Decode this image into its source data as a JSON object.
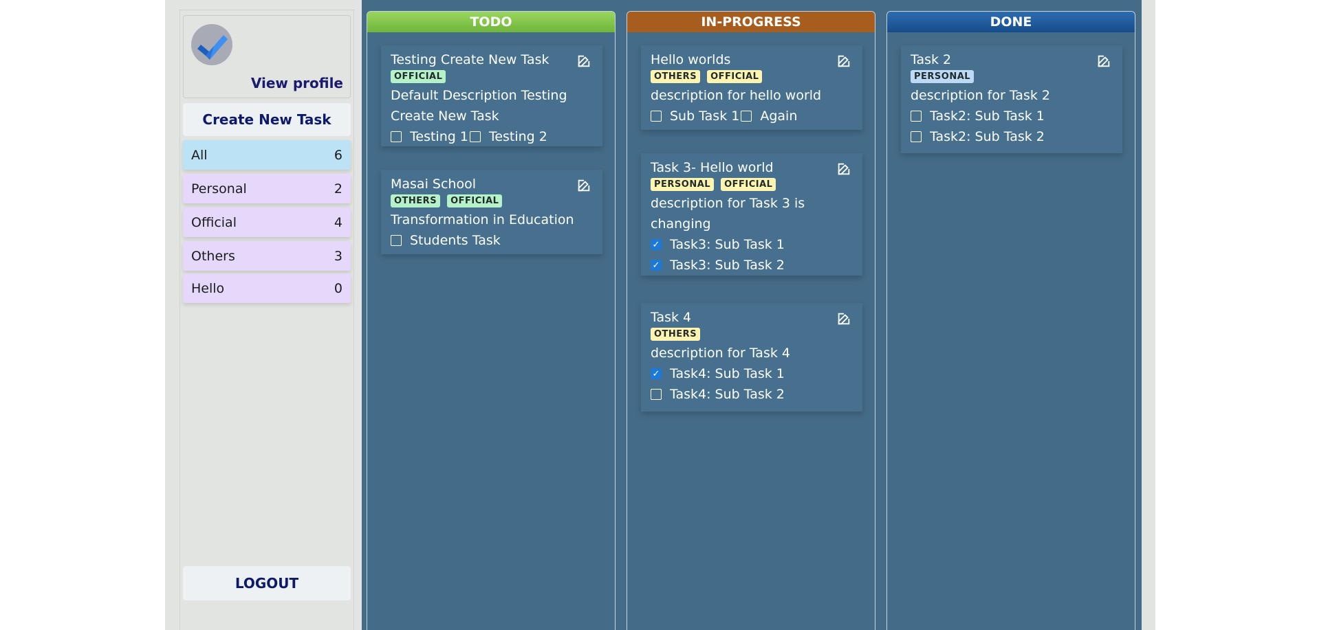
{
  "sidebar": {
    "view_profile": "View profile",
    "create_task": "Create New Task",
    "logout": "LOGOUT",
    "categories": [
      {
        "label": "All",
        "count": "6"
      },
      {
        "label": "Personal",
        "count": "2"
      },
      {
        "label": "Official",
        "count": "4"
      },
      {
        "label": "Others",
        "count": "3"
      },
      {
        "label": "Hello",
        "count": "0"
      }
    ]
  },
  "colors": {
    "todo": "#7cc243",
    "inprogress": "#a65d1d",
    "done": "#1f5799",
    "board": "#446b88"
  },
  "columns": {
    "todo": {
      "title": "TODO",
      "cards": [
        {
          "title": "Testing Create New Task",
          "tags": [
            "OFFICIAL"
          ],
          "description": "Default Description Testing Create New Task",
          "subtasks": [
            {
              "label": "Testing 1",
              "checked": false
            },
            {
              "label": "Testing 2",
              "checked": false
            }
          ]
        },
        {
          "title": "Masai School",
          "tags": [
            "OTHERS",
            "OFFICIAL"
          ],
          "description": "Transformation in Education",
          "subtasks": [
            {
              "label": "Students Task",
              "checked": false
            }
          ]
        }
      ]
    },
    "inprogress": {
      "title": "IN-PROGRESS",
      "cards": [
        {
          "title": "Hello worlds",
          "tags": [
            "OTHERS",
            "OFFICIAL"
          ],
          "description": "description for hello world",
          "subtasks": [
            {
              "label": "Sub Task 1",
              "checked": false
            },
            {
              "label": "Again",
              "checked": false
            }
          ]
        },
        {
          "title": "Task 3- Hello world",
          "tags": [
            "PERSONAL",
            "OFFICIAL"
          ],
          "description": "description for Task 3 is changing",
          "subtasks": [
            {
              "label": "Task3: Sub Task 1",
              "checked": true
            },
            {
              "label": "Task3: Sub Task 2",
              "checked": true
            }
          ]
        },
        {
          "title": "Task 4",
          "tags": [
            "OTHERS"
          ],
          "description": "description for Task 4",
          "subtasks": [
            {
              "label": "Task4: Sub Task 1",
              "checked": true
            },
            {
              "label": "Task4: Sub Task 2",
              "checked": false
            }
          ]
        }
      ]
    },
    "done": {
      "title": "DONE",
      "cards": [
        {
          "title": "Task 2",
          "tags": [
            "PERSONAL"
          ],
          "description": "description for Task 2",
          "subtasks": [
            {
              "label": "Task2: Sub Task 1",
              "checked": false
            },
            {
              "label": "Task2: Sub Task 2",
              "checked": false
            }
          ]
        }
      ]
    }
  },
  "icons": {
    "logo": "checkmark-logo-icon",
    "edit": "edit-icon",
    "checkbox": "checkbox-icon"
  }
}
